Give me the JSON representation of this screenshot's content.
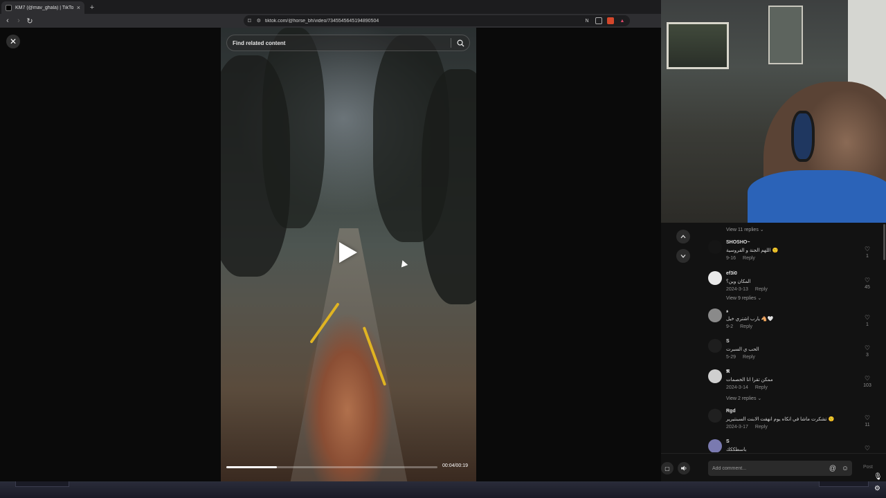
{
  "browser": {
    "tab_title": "KM7 (@mav_ghala) | TikTok",
    "tab_close": "×",
    "new_tab": "+",
    "url": "tiktok.com/@horse_bh/video/7345545645194890504"
  },
  "player": {
    "close": "✕",
    "search_placeholder": "Find related content",
    "progress_percent": 24,
    "time": "00:04/00:19"
  },
  "comments": {
    "view_replies_top": "View 11 replies ⌄",
    "items": [
      {
        "user": "SHOSHO~",
        "text": "اللهم الجنة و الفروسية 🙂",
        "date": "9-16",
        "reply": "Reply",
        "likes": "1",
        "avatar": "#151515"
      },
      {
        "user": "ef3i0",
        "text": "المكان وين؟",
        "date": "2024-3-13",
        "reply": "Reply",
        "likes": "45",
        "avatar": "#e8e8e8",
        "view_replies": "View 9 replies ⌄"
      },
      {
        "user": "ء",
        "text": "يارب اشتري خيل 🐴🤍",
        "date": "9-2",
        "reply": "Reply",
        "likes": "1",
        "avatar": "#8a8a8a"
      },
      {
        "user": "S",
        "text": "الحب ي السبرت",
        "date": "5-29",
        "reply": "Reply",
        "likes": "3",
        "avatar": "#1e1e1e"
      },
      {
        "user": "𝕽",
        "text": "ممكن تقرا انا الخصمات",
        "date": "2024-3-14",
        "reply": "Reply",
        "likes": "103",
        "avatar": "#cfcfcf",
        "view_replies": "View 2 replies ⌄"
      },
      {
        "user": "Rgd",
        "text": "تشكرت ماشا في انكاه يوم انهقت الابنت السبنتيرير 🙂",
        "date": "2024-3-17",
        "reply": "Reply",
        "likes": "11",
        "avatar": "#202020"
      },
      {
        "user": "S",
        "text": "باسطككك",
        "date": "",
        "reply": "",
        "likes": "",
        "avatar": "#7a7ab0"
      }
    ]
  },
  "composer": {
    "placeholder": "Add comment...",
    "mention_icon": "@",
    "emoji_icon": "☺",
    "post_label": "Post"
  }
}
